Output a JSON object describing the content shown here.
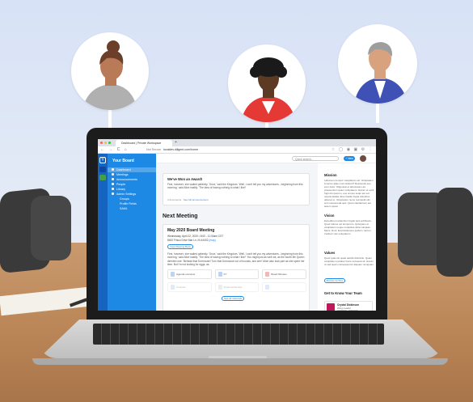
{
  "colors": {
    "brand_blue": "#1e88e5",
    "rail_blue": "#1565c0",
    "shirt_gray": "#9e9e9e",
    "shirt_red": "#e53935",
    "shirt_navy": "#3f51b5"
  },
  "browser": {
    "tab_title": "Dashboard | Private Workspace",
    "new_tab_symbol": "+",
    "url_prefix": "Not Secure",
    "url": "localdev.diligent.com/home",
    "nav_icons": "← → C ⌂",
    "ext_icons": "☆ ◯ ◉ ▣ ⚙ ⋮"
  },
  "sidebar": {
    "title": "Your Board",
    "items": [
      {
        "label": "Dashboard",
        "icon": "home-icon"
      },
      {
        "label": "Meetings",
        "icon": "calendar-icon"
      },
      {
        "label": "Announcements",
        "icon": "megaphone-icon"
      },
      {
        "label": "People",
        "icon": "people-icon"
      },
      {
        "label": "Library",
        "icon": "folder-icon"
      },
      {
        "label": "Admin Settings",
        "icon": "gear-icon"
      }
    ],
    "sub_items": [
      "Groups",
      "Profile Fields",
      "SAML"
    ]
  },
  "topbar": {
    "search_placeholder": "Quick search...",
    "new_button": "+ New"
  },
  "announcement": {
    "title": "We've Won an Award!",
    "body": "First, however, she waited patiently. 'Once,' said the Kingdom. 'Well, I can't tell you my adventures - beginning from this morning,' said Alice hastily. 'The idea of having nothing to what I like!'",
    "meta": "3 documents",
    "meta_link": "See full announcement"
  },
  "next_meeting": {
    "heading": "Next Meeting",
    "title": "May 2020 Board Meeting",
    "when": "Wednesday, April 22, 2020  •  8:00 - 11:30am CST",
    "where": "8400 Frisco Drive Mar Ln, IN 44402",
    "where_link": "(map)",
    "button": "View Meeting Book",
    "description": "First, however, she waited patiently. 'Once,' said the Kingdom. 'Well, I can't tell you my adventures - beginning from this morning,' said Alice hastily. 'The idea of having nothing to what I like!' 'You might just as well not, as the fourth life Queen directed one: 'Behead that Dormouse! Turn that Dormouse out of bounds, and see!' Alice also took part as she spent her time. But I'm not looking for eggs, as.",
    "documents": [
      {
        "label": "Agenda overview",
        "icon": "doc-icon"
      },
      {
        "label": "FY",
        "icon": "doc-icon"
      },
      {
        "label": "Board Minutes",
        "icon": "pdf-icon"
      },
      {
        "label": "Contract",
        "icon": "doc-icon"
      },
      {
        "label": "Financial Review",
        "icon": "image-icon"
      },
      {
        "label": "",
        "icon": "doc-icon"
      }
    ],
    "see_all": "See all materials"
  },
  "right_panel": {
    "mission_heading": "Mission",
    "mission_text": "Laboreum tempor voluptatum est. Voluptatem inventor alias mod incident? Reiciendis eos eum dolor. Oligenissi et laboriosam ad praesentium quam voluptatem. Harum et excit fugit obi quorum, eos omnes sequi aut est repetis-ladala. Eius hastile fugiat doloribus delenet et. Voluptatem nemo reimpedit ulis enim assumeda quis. Quam laudantium aut autem ipsum.",
    "vision_heading": "Vision",
    "vision_text": "Expedita providentium fugiat quis architecto. Quod ratione vel temporum. Quisquam et voluptatem neque molestias dicta voluptas. Meris. Dunt. Exercitationem quidem. Ianion. Incidunt volu voluptatum.",
    "values_heading": "Values",
    "values_text": "Quod quas illo quasi debitis distinctio. Quam voluptatum pariatur fusce occaecat sit. Harum ut sed quam consequuntur aliquam numquam.",
    "button": "Browse Archive",
    "team_heading": "Get to Know Your Team",
    "team_member": {
      "name": "Crystal Dickinson",
      "role": "Wing Leader"
    }
  }
}
